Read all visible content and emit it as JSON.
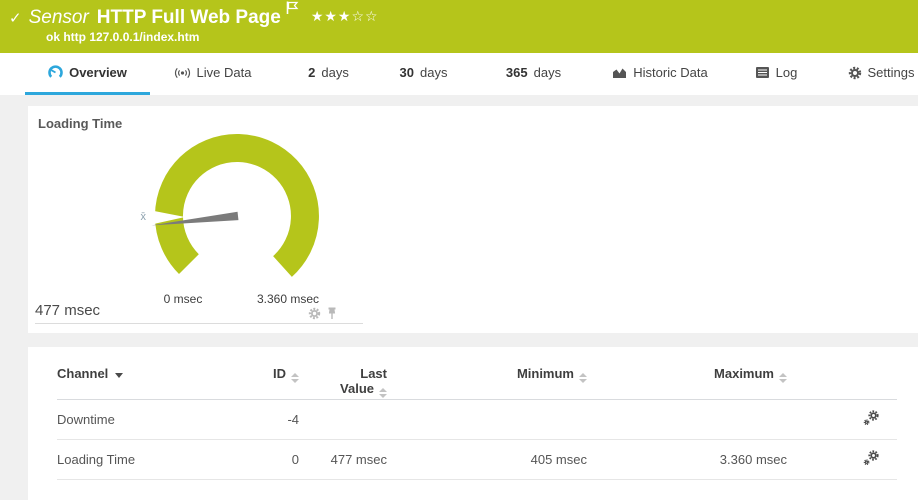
{
  "header": {
    "check": "✓",
    "type_label": "Sensor",
    "title": "HTTP Full Web Page",
    "rating": {
      "filled": 3,
      "total": 5,
      "stars_filled": "★★★",
      "stars_empty": "☆☆"
    },
    "status_line": "ok http 127.0.0.1/index.htm",
    "banner_color": "#b5c51b"
  },
  "tabs": {
    "overview": {
      "label": "Overview",
      "active": true
    },
    "live_data": {
      "label": "Live Data"
    },
    "days2": {
      "num": "2",
      "label": "days"
    },
    "days30": {
      "num": "30",
      "label": "days"
    },
    "days365": {
      "num": "365",
      "label": "days"
    },
    "historic": {
      "label": "Historic Data"
    },
    "log": {
      "label": "Log"
    },
    "settings": {
      "label": "Settings"
    }
  },
  "gauge": {
    "title": "Loading Time",
    "value": 477,
    "min": 0,
    "max": 3360,
    "value_label": "477 msec",
    "min_label": "0 msec",
    "max_label": "3.360 msec",
    "avg_marker": "x̄",
    "color": "#b5c51b",
    "needle_color": "#7b7b7b"
  },
  "channels": {
    "headers": {
      "channel": "Channel",
      "id": "ID",
      "last_value": "Last Value",
      "minimum": "Minimum",
      "maximum": "Maximum"
    },
    "rows": [
      {
        "channel": "Downtime",
        "id": "-4",
        "last": "",
        "min": "",
        "max": ""
      },
      {
        "channel": "Loading Time",
        "id": "0",
        "last": "477 msec",
        "min": "405 msec",
        "max": "3.360 msec"
      }
    ]
  }
}
